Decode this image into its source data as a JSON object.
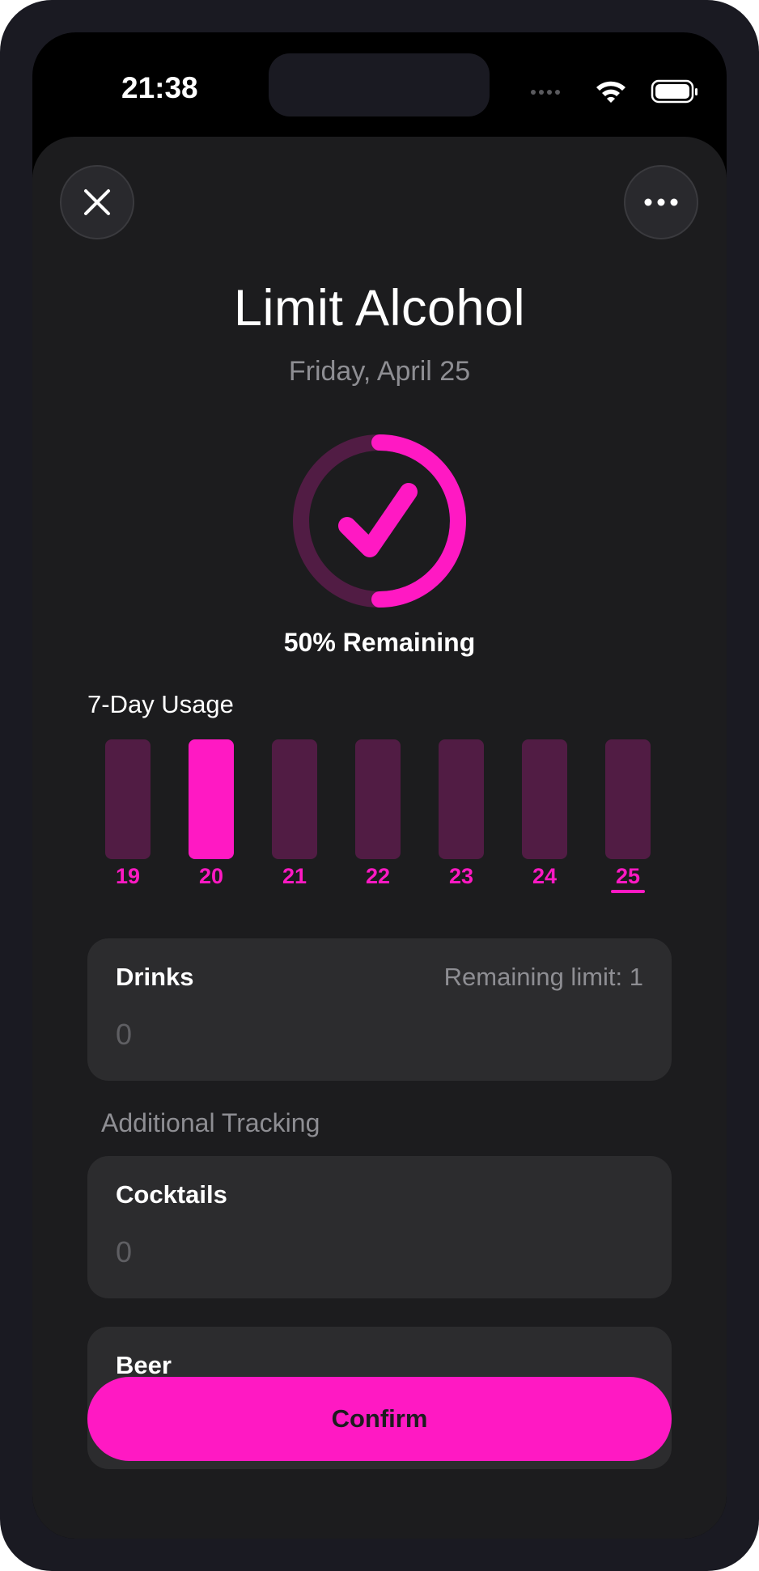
{
  "status_bar": {
    "time": "21:38"
  },
  "header": {
    "close_icon": "close-icon",
    "more_icon": "more-icon"
  },
  "habit": {
    "title": "Limit Alcohol",
    "date": "Friday, April 25",
    "progress_remaining_percent": 50,
    "remaining_label": "50% Remaining"
  },
  "usage": {
    "title": "7-Day Usage",
    "days": [
      {
        "label": "19",
        "highlighted": false
      },
      {
        "label": "20",
        "highlighted": true
      },
      {
        "label": "21",
        "highlighted": false
      },
      {
        "label": "22",
        "highlighted": false
      },
      {
        "label": "23",
        "highlighted": false
      },
      {
        "label": "24",
        "highlighted": false
      },
      {
        "label": "25",
        "highlighted": false,
        "selected": true
      }
    ]
  },
  "drinks": {
    "label": "Drinks",
    "remaining_limit": "Remaining limit: 1",
    "value": "0"
  },
  "additional": {
    "title": "Additional Tracking",
    "items": [
      {
        "label": "Cocktails",
        "value": "0"
      },
      {
        "label": "Beer"
      }
    ]
  },
  "actions": {
    "confirm_label": "Confirm"
  },
  "colors": {
    "accent": "#ff19c3",
    "accent_dim": "#511c44",
    "background": "#1c1c1e",
    "card": "#2c2c2e"
  }
}
